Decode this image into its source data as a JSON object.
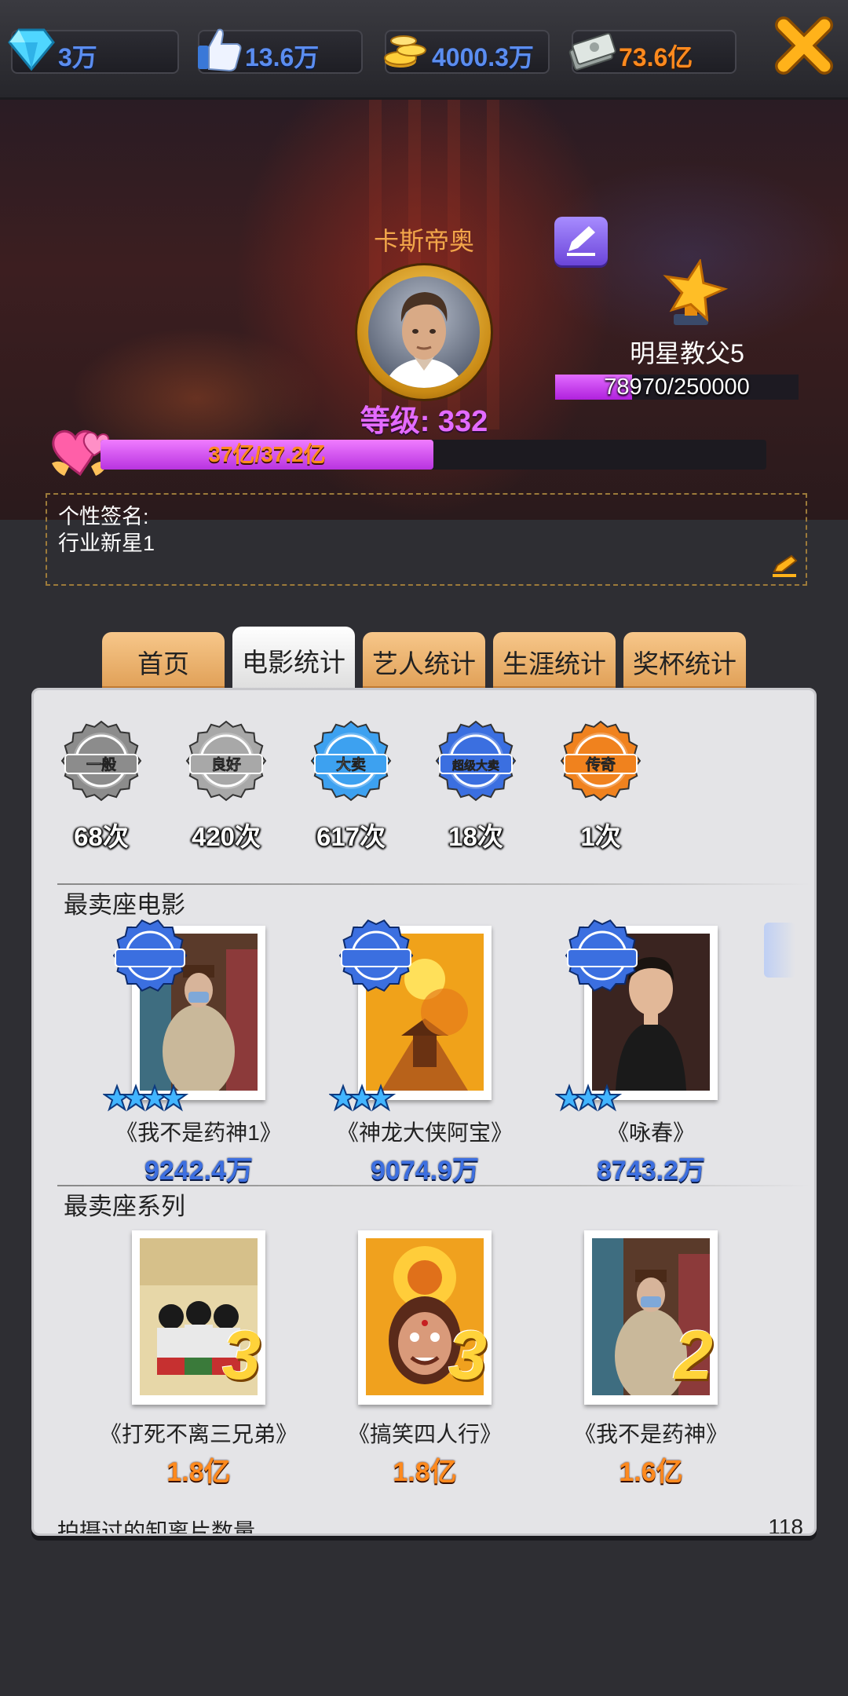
{
  "resources": {
    "diamonds": "3万",
    "likes": "13.6万",
    "coins": "4000.3万",
    "cash": "73.6亿"
  },
  "profile": {
    "name": "卡斯帝奥",
    "level_text": "等级:  332",
    "title_name": "明星教父5",
    "title_progress_text": "78970/250000",
    "title_progress": 0.316,
    "wealth_text": "37亿/37.2亿",
    "wealth_progress": 0.5,
    "signature_label": "个性签名:",
    "signature_text": "行业新星1"
  },
  "tabs": [
    {
      "label": "首页",
      "active": false
    },
    {
      "label": "电影统计",
      "active": true
    },
    {
      "label": "艺人统计",
      "active": false
    },
    {
      "label": "生涯统计",
      "active": false
    },
    {
      "label": "奖杯统计",
      "active": false
    }
  ],
  "badges": [
    {
      "label": "一般",
      "count": "68次",
      "color": "#8c8c8c"
    },
    {
      "label": "良好",
      "count": "420次",
      "color": "#a8a8a8"
    },
    {
      "label": "大卖",
      "count": "617次",
      "color": "#3da1f0"
    },
    {
      "label": "超级大卖",
      "count": "18次",
      "color": "#3b6fe0"
    },
    {
      "label": "传奇",
      "count": "1次",
      "color": "#f0821e"
    }
  ],
  "best_movies_title": "最卖座电影",
  "best_movies": [
    {
      "name": "《我不是药神1》",
      "gross": "9242.4万",
      "badge": "超级大卖",
      "stars": 4
    },
    {
      "name": "《神龙大侠阿宝》",
      "gross": "9074.9万",
      "badge": "超级大卖",
      "stars": 3
    },
    {
      "name": "《咏春》",
      "gross": "8743.2万",
      "badge": "超级大卖",
      "stars": 3
    }
  ],
  "best_series_title": "最卖座系列",
  "best_series": [
    {
      "name": "《打死不离三兄弟》",
      "gross": "1.8亿",
      "sequel": "3"
    },
    {
      "name": "《搞笑四人行》",
      "gross": "1.8亿",
      "sequel": "3"
    },
    {
      "name": "《我不是药神》",
      "gross": "1.6亿",
      "sequel": "2"
    }
  ],
  "footer_label": "拍摄过的卸离片数量",
  "footer_value": "118"
}
